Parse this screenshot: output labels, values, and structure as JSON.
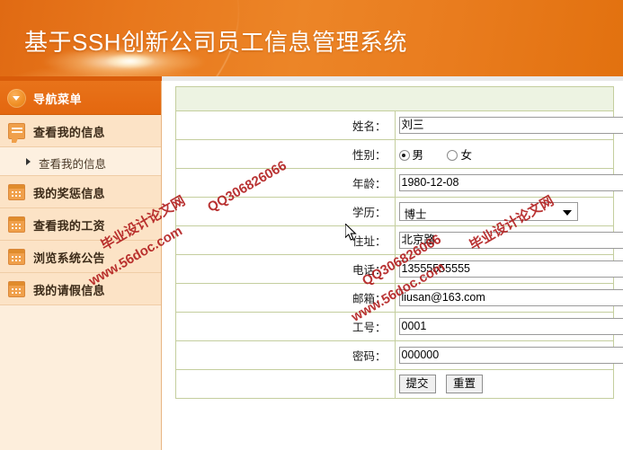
{
  "banner": {
    "title": "基于SSH创新公司员工信息管理系统"
  },
  "sidebar": {
    "nav_header": {
      "label": "导航菜单",
      "icon": "chevron-down-circle-icon"
    },
    "items": [
      {
        "label": "查看我的信息",
        "icon": "chat-bubble-icon",
        "type": "item"
      },
      {
        "label": "查看我的信息",
        "icon": "triangle-right-icon",
        "type": "sub"
      },
      {
        "label": "我的奖惩信息",
        "icon": "calendar-icon",
        "type": "item"
      },
      {
        "label": "查看我的工资",
        "icon": "calendar-icon",
        "type": "item"
      },
      {
        "label": "浏览系统公告",
        "icon": "calendar-icon",
        "type": "item"
      },
      {
        "label": "我的请假信息",
        "icon": "calendar-icon",
        "type": "item"
      }
    ]
  },
  "form": {
    "fields": {
      "name": {
        "label": "姓名：",
        "value": "刘三"
      },
      "gender": {
        "label": "性别：",
        "options": [
          {
            "label": "男",
            "selected": true
          },
          {
            "label": "女",
            "selected": false
          }
        ]
      },
      "age": {
        "label": "年龄：",
        "value": "1980-12-08"
      },
      "education": {
        "label": "学历：",
        "value": "博士"
      },
      "address": {
        "label": "住址：",
        "value": "北京路"
      },
      "phone": {
        "label": "电话：",
        "value": "13555555555"
      },
      "email": {
        "label": "邮箱：",
        "value": "liusan@163.com"
      },
      "employee_no": {
        "label": "工号：",
        "value": "0001"
      },
      "password": {
        "label": "密码：",
        "value": "000000"
      }
    },
    "buttons": {
      "submit": "提交",
      "reset": "重置"
    }
  },
  "watermarks": {
    "site_cn": "毕业设计论文网",
    "site_url": "www.56doc.com",
    "qq": "QQ306826066"
  },
  "colors": {
    "banner_orange": "#e8781d",
    "nav_header_orange": "#e4670f",
    "nav_item_bg": "#fce3c6",
    "sidebar_bg": "#fdeedc",
    "table_border": "#c4ce9e",
    "table_header_bg": "#edf3e2",
    "watermark_red": "#b01818"
  }
}
